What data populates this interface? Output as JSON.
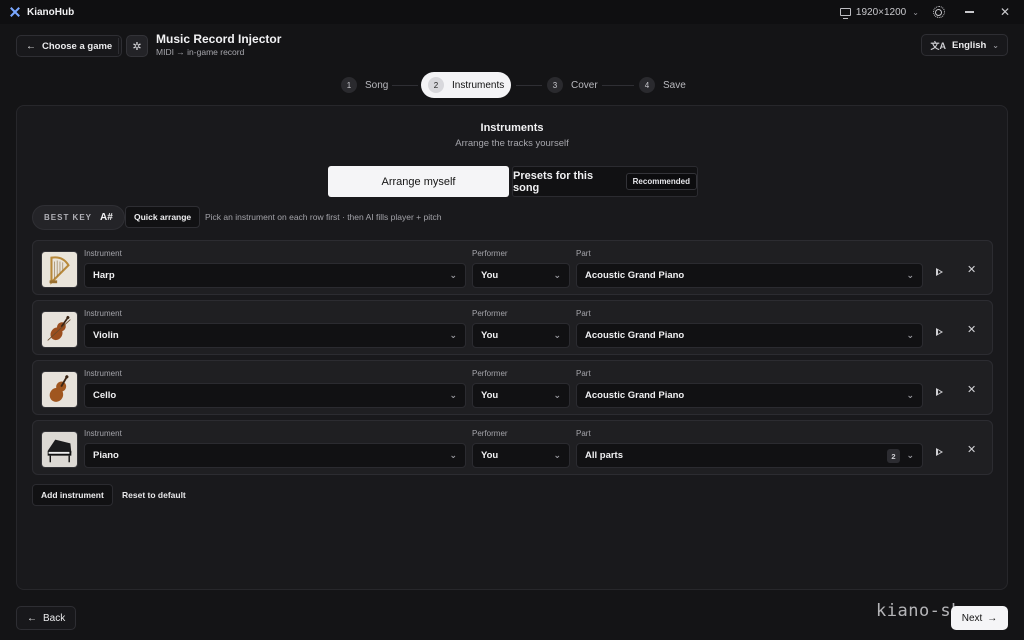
{
  "app": {
    "name": "KianoHub"
  },
  "titlebar": {
    "resolution": "1920×1200"
  },
  "header": {
    "back_label": "Choose a game",
    "module_title": "Music Record Injector",
    "module_subtitle": "MIDI → in-game record",
    "language": "English"
  },
  "steps": [
    {
      "num": "1",
      "label": "Song"
    },
    {
      "num": "2",
      "label": "Instruments",
      "active": true
    },
    {
      "num": "3",
      "label": "Cover"
    },
    {
      "num": "4",
      "label": "Save"
    }
  ],
  "panel": {
    "title": "Instruments",
    "subtitle": "Arrange the tracks yourself",
    "mode_manual": "Arrange myself",
    "mode_presets": "Presets for this song",
    "recommended_badge": "Recommended",
    "best_key_label": "BEST KEY",
    "best_key_value": "A#",
    "quick_arrange": "Quick arrange",
    "hint": "Pick an instrument on each row first · then AI fills player + pitch"
  },
  "labels": {
    "instrument": "Instrument",
    "performer": "Performer",
    "part": "Part"
  },
  "rows": [
    {
      "icon": "harp-icon",
      "instrument": "Harp",
      "performer": "You",
      "part": "Acoustic Grand Piano"
    },
    {
      "icon": "violin-icon",
      "instrument": "Violin",
      "performer": "You",
      "part": "Acoustic Grand Piano"
    },
    {
      "icon": "cello-icon",
      "instrument": "Cello",
      "performer": "You",
      "part": "Acoustic Grand Piano"
    },
    {
      "icon": "piano-icon",
      "instrument": "Piano",
      "performer": "You",
      "part": "All parts",
      "part_count": "2"
    }
  ],
  "actions": {
    "add_instrument": "Add instrument",
    "reset": "Reset to default"
  },
  "footer": {
    "back": "Back",
    "next": "Next",
    "watermark": "kiano-sho"
  },
  "colors": {
    "background": "#141416",
    "panel": "#19191c",
    "accent": "#f5f5f7"
  }
}
